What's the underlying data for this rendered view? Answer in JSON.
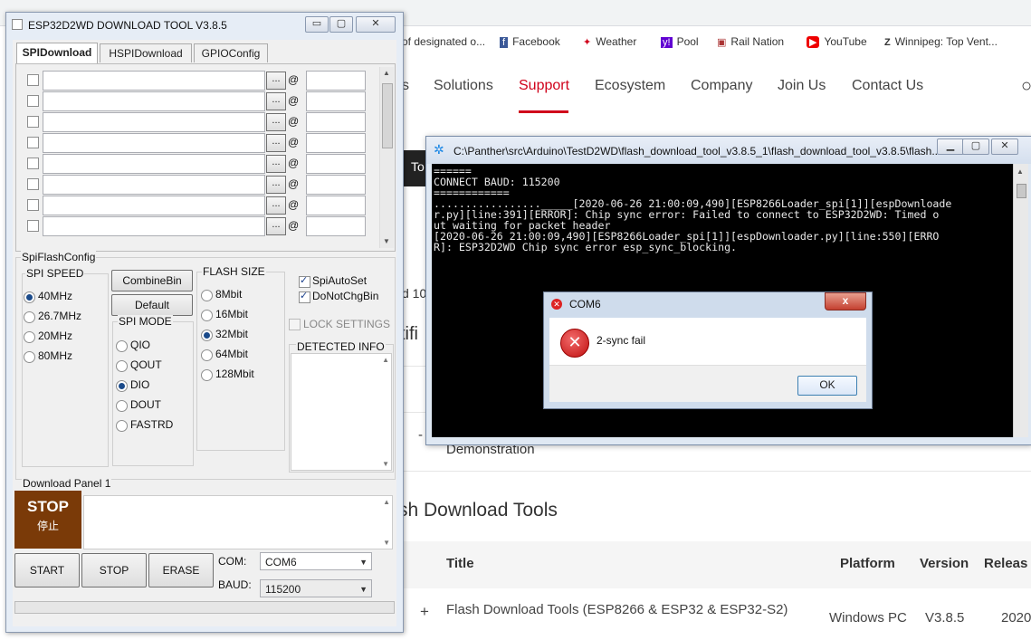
{
  "web": {
    "bookmarks": [
      {
        "label": "of designated o...",
        "icon": "document-icon"
      },
      {
        "label": "Facebook",
        "icon": "facebook-icon"
      },
      {
        "label": "Weather",
        "icon": "maple-leaf-icon"
      },
      {
        "label": "Pool",
        "icon": "yahoo-icon"
      },
      {
        "label": "Rail Nation",
        "icon": "rail-nation-icon"
      },
      {
        "label": "YouTube",
        "icon": "youtube-icon"
      },
      {
        "label": "Winnipeg: Top Vent...",
        "icon": "z-icon"
      }
    ],
    "nav": [
      "s",
      "Solutions",
      "Support",
      "Ecosystem",
      "Company",
      "Join Us",
      "Contact Us"
    ],
    "nav_active": "Support",
    "black_bar_text": "To",
    "fragment_1": "d 10",
    "fragment_2": "tifi",
    "demonstration": "Demonstration",
    "section_title": "sh Download Tools",
    "table": {
      "headers": [
        "Title",
        "Platform",
        "Version",
        "Releas"
      ],
      "row": {
        "expand": "+",
        "title": "Flash Download Tools (ESP8266 & ESP32 & ESP32-S2)",
        "platform": "Windows PC",
        "version": "V3.8.5",
        "release": "2020"
      }
    },
    "colors": {
      "accent": "#d0021b"
    }
  },
  "console": {
    "title": "C:\\Panther\\src\\Arduino\\TestD2WD\\flash_download_tool_v3.8.5_1\\flash_download_tool_v3.8.5\\flash...",
    "lines": [
      "======",
      "CONNECT BAUD: 115200",
      "============",
      "................._____[2020-06-26 21:00:09,490][ESP8266Loader_spi[1]][espDownloade",
      "r.py][line:391][ERROR]: Chip sync error: Failed to connect to ESP32D2WD: Timed o",
      "ut waiting for packet header",
      "[2020-06-26 21:00:09,490][ESP8266Loader_spi[1]][espDownloader.py][line:550][ERRO",
      "R]: ESP32D2WD Chip sync error esp_sync_blocking."
    ]
  },
  "dialog": {
    "title": "COM6",
    "message": "2-sync fail",
    "ok_label": "OK",
    "close_label": "x"
  },
  "tool": {
    "title": "ESP32D2WD DOWNLOAD TOOL V3.8.5",
    "window_buttons": {
      "minimize": "▭",
      "maximize": "▢",
      "close": "✕"
    },
    "tabs": [
      "SPIDownload",
      "HSPIDownload",
      "GPIOConfig"
    ],
    "active_tab": "SPIDownload",
    "file_rows": [
      {
        "path": "",
        "address": "",
        "checked": false
      },
      {
        "path": "",
        "address": "",
        "checked": false
      },
      {
        "path": "",
        "address": "",
        "checked": false
      },
      {
        "path": "",
        "address": "",
        "checked": false
      },
      {
        "path": "",
        "address": "",
        "checked": false
      },
      {
        "path": "",
        "address": "",
        "checked": false
      },
      {
        "path": "",
        "address": "",
        "checked": false
      },
      {
        "path": "",
        "address": "",
        "checked": false
      }
    ],
    "browse_label": "...",
    "at_label": "@",
    "spi_flash_config": "SpiFlashConfig",
    "spi_speed": {
      "label": "SPI SPEED",
      "options": [
        "40MHz",
        "26.7MHz",
        "20MHz",
        "80MHz"
      ],
      "selected": "40MHz"
    },
    "combine_bin": "CombineBin",
    "default": "Default",
    "spi_mode": {
      "label": "SPI MODE",
      "options": [
        "QIO",
        "QOUT",
        "DIO",
        "DOUT",
        "FASTRD"
      ],
      "selected": "DIO"
    },
    "flash_size": {
      "label": "FLASH SIZE",
      "options": [
        "8Mbit",
        "16Mbit",
        "32Mbit",
        "64Mbit",
        "128Mbit"
      ],
      "selected": "32Mbit"
    },
    "spi_auto_set": {
      "label": "SpiAutoSet",
      "checked": true
    },
    "do_not_chg_bin": {
      "label": "DoNotChgBin",
      "checked": true
    },
    "lock_settings": {
      "label": "LOCK SETTINGS",
      "checked": false
    },
    "detected_info": "DETECTED INFO",
    "download_panel": "Download Panel 1",
    "stop_tile": {
      "text": "STOP",
      "subtext": "停止",
      "color": "#7a3a08"
    },
    "buttons": {
      "start": "START",
      "stop": "STOP",
      "erase": "ERASE"
    },
    "com": {
      "label": "COM:",
      "value": "COM6"
    },
    "baud": {
      "label": "BAUD:",
      "value": "115200"
    }
  }
}
